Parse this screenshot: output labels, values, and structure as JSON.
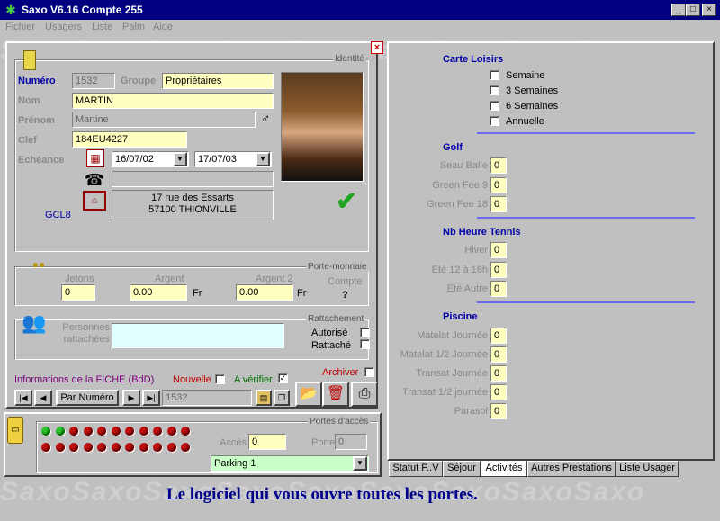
{
  "window": {
    "title": "Saxo  V6.16  Compte 255"
  },
  "menu": [
    "Fichier",
    "Usagers",
    "Liste",
    "Palm",
    "Aide"
  ],
  "watermark_text": "SaxoSaxoSaxoSaxoSaxoSaxoSaxoSaxoSaxo",
  "identity": {
    "group_title": "Identité",
    "numero_label": "Numéro",
    "numero": "1532",
    "groupe_label": "Groupe",
    "groupe": "Propriétaires",
    "nom_label": "Nom",
    "nom": "MARTIN",
    "prenom_label": "Prénom",
    "prenom": "Martine",
    "clef_label": "Clef",
    "clef": "184EU4227",
    "echeance_label": "Echéance",
    "date_start": "16/07/02",
    "date_end": "17/07/03",
    "phone": "",
    "address_line1": "17 rue des Essarts",
    "address_line2": "57100 THIONVILLE",
    "code": "GCL8"
  },
  "wallet": {
    "group_title": "Porte-monnaie",
    "jetons_label": "Jetons",
    "jetons": "0",
    "argent_label": "Argent",
    "argent": "0.00",
    "argent2_label": "Argent 2",
    "argent2": "0.00",
    "fr": "Fr",
    "compte_label": "Compte",
    "compte_value": "?"
  },
  "rattachement": {
    "group_title": "Rattachement",
    "persons_label": "Personnes rattachées",
    "autorise_label": "Autorisé",
    "rattache_label": "Rattaché"
  },
  "fiche": {
    "info_label": "Informations de la FICHE (BdD)",
    "nouvelle_label": "Nouvelle",
    "verifier_label": "A vérifier",
    "archiver_label": "Archiver",
    "sort_label": "Par Numéro",
    "record_number": "1532"
  },
  "access": {
    "group_title": "Portes d'accès",
    "acces_label": "Accès",
    "acces": "0",
    "porte_label": "Porte",
    "porte": "0",
    "parking": "Parking 1",
    "leds_on": 2,
    "leds_total": 22
  },
  "activities": {
    "carte_loisirs": {
      "title": "Carte Loisirs",
      "options": [
        "Semaine",
        "3 Semaines",
        "6 Semaines",
        "Annuelle"
      ]
    },
    "golf": {
      "title": "Golf",
      "items": [
        {
          "label": "Seau Balle",
          "value": "0"
        },
        {
          "label": "Green Fee 9",
          "value": "0"
        },
        {
          "label": "Green Fee 18",
          "value": "0"
        }
      ]
    },
    "tennis": {
      "title": "Nb Heure Tennis",
      "items": [
        {
          "label": "Hiver",
          "value": "0"
        },
        {
          "label": "Eté 12 à 16h",
          "value": "0"
        },
        {
          "label": "Eté Autre",
          "value": "0"
        }
      ]
    },
    "piscine": {
      "title": "Piscine",
      "items": [
        {
          "label": "Matelat Journée",
          "value": "0"
        },
        {
          "label": "Matelat 1/2 Journée",
          "value": "0"
        },
        {
          "label": "Transat Journée",
          "value": "0"
        },
        {
          "label": "Transat 1/2 journée",
          "value": "0"
        },
        {
          "label": "Parasol",
          "value": "0"
        }
      ]
    }
  },
  "tabs": [
    "Statut P..V",
    "Séjour",
    "Activités",
    "Autres Prestations",
    "Liste Usager"
  ],
  "slogan": "Le logiciel qui vous ouvre toutes les portes."
}
